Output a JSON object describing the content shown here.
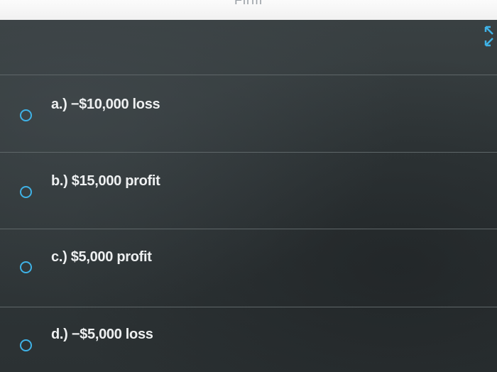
{
  "header": {
    "title": "Firm"
  },
  "question": {
    "options": [
      {
        "label": "a.) −$10,000 loss",
        "selected": false
      },
      {
        "label": "b.) $15,000 profit",
        "selected": false
      },
      {
        "label": "c.) $5,000 profit",
        "selected": false
      },
      {
        "label": "d.) −$5,000 loss",
        "selected": false
      }
    ]
  },
  "colors": {
    "radio_accent": "#3fb2e6",
    "panel_bg": "#2f3537",
    "text": "#eef0f1"
  },
  "icons": {
    "expand": "expand-icon"
  }
}
